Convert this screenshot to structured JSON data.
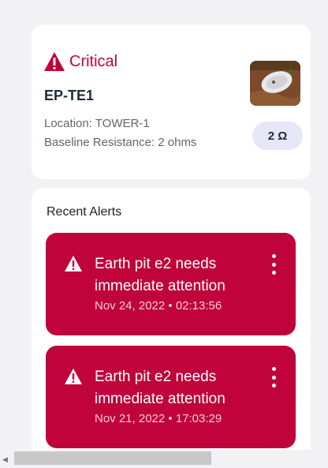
{
  "status": {
    "label": "Critical",
    "device_id": "EP-TE1",
    "location": "Location: TOWER-1",
    "baseline": "Baseline Resistance: 2 ohms",
    "resistance_badge": "2 Ω",
    "colors": {
      "critical": "#c0033b",
      "badge_bg": "#e7e6f7"
    },
    "icon": "warning-triangle-icon"
  },
  "alerts": {
    "title": "Recent Alerts",
    "items": [
      {
        "message": "Earth pit e2 needs immediate attention",
        "time": "Nov 24, 2022 • 02:13:56"
      },
      {
        "message": "Earth pit e2 needs immediate attention",
        "time": "Nov 21, 2022 • 17:03:29"
      }
    ]
  }
}
